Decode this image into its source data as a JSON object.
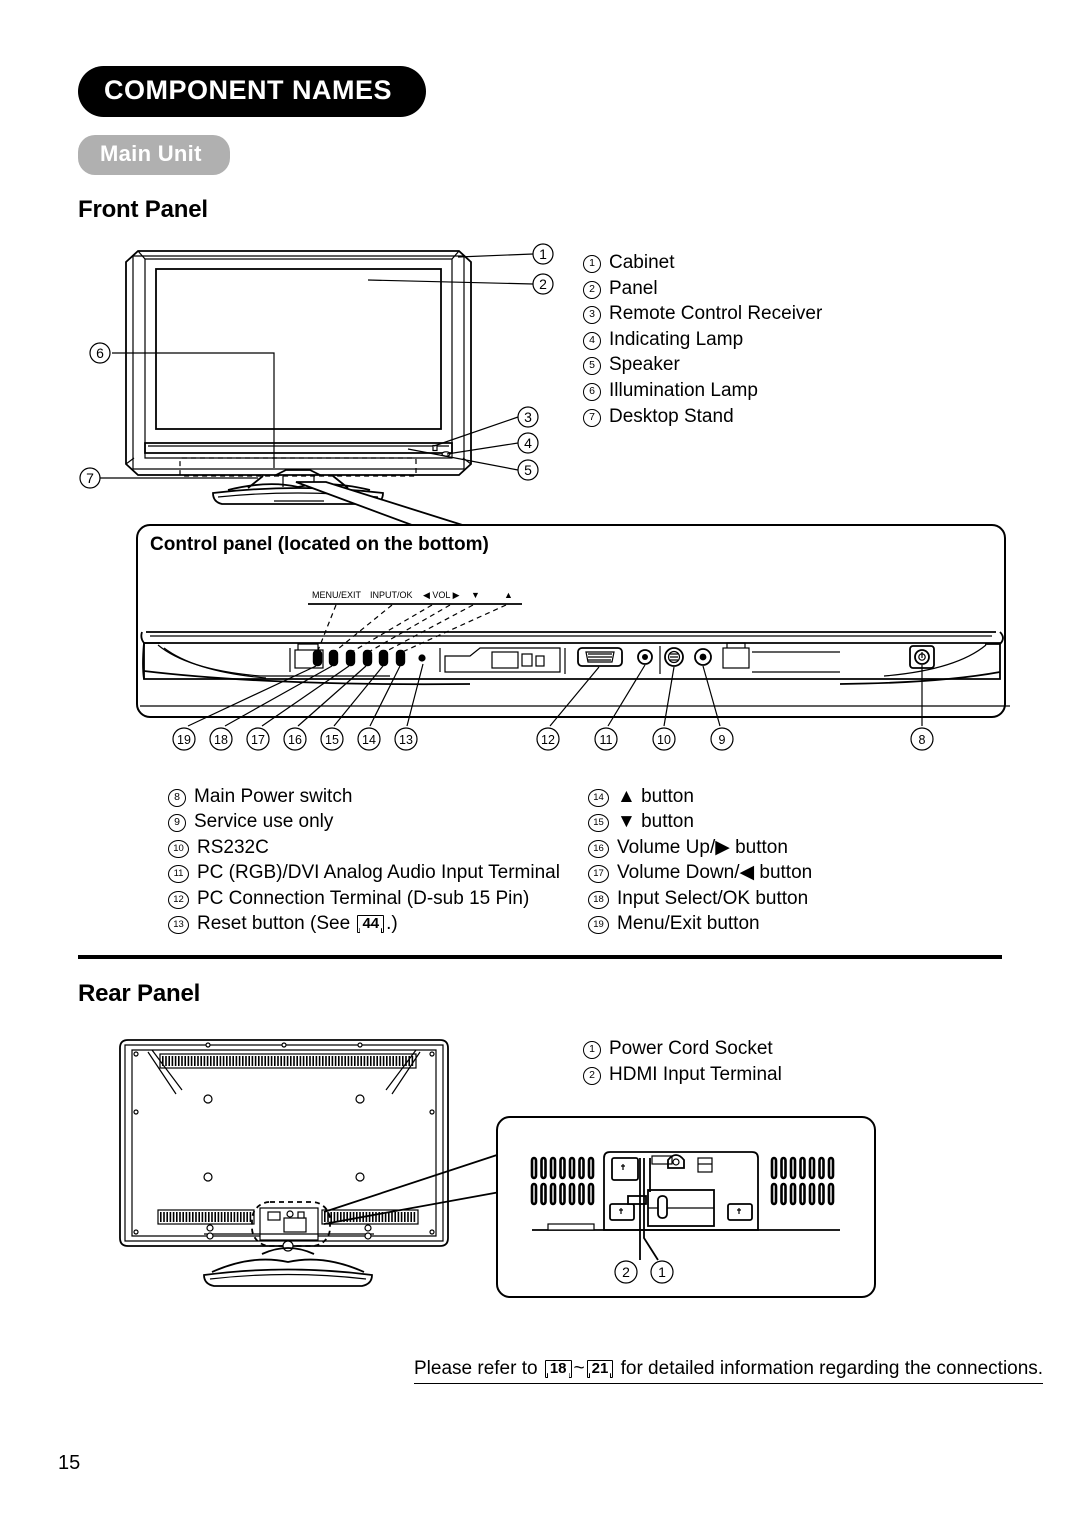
{
  "document": {
    "chapter_title": "COMPONENT NAMES",
    "subsection_title": "Main Unit",
    "page_number": "15"
  },
  "front_panel": {
    "heading": "Front Panel",
    "items": [
      {
        "num": "①",
        "n": "1",
        "label": "Cabinet"
      },
      {
        "num": "②",
        "n": "2",
        "label": "Panel"
      },
      {
        "num": "③",
        "n": "3",
        "label": "Remote Control Receiver"
      },
      {
        "num": "④",
        "n": "4",
        "label": "Indicating Lamp"
      },
      {
        "num": "⑤",
        "n": "5",
        "label": "Speaker"
      },
      {
        "num": "⑥",
        "n": "6",
        "label": "Illumination Lamp"
      },
      {
        "num": "⑦",
        "n": "7",
        "label": "Desktop Stand"
      }
    ],
    "diagram_callouts": [
      "1",
      "2",
      "3",
      "4",
      "5",
      "6",
      "7"
    ]
  },
  "control_panel": {
    "box_title": "Control panel (located on the bottom)",
    "button_labels": [
      "MENU/EXIT",
      "INPUT/OK",
      "◀ VOL ▶",
      "▼",
      "▲"
    ],
    "diagram_callouts_left": [
      "19",
      "18",
      "17",
      "16",
      "15",
      "14",
      "13"
    ],
    "diagram_callouts_right": [
      "12",
      "11",
      "10",
      "9"
    ],
    "diagram_callout_far": "8",
    "items_left": [
      {
        "n": "8",
        "label": "Main Power switch"
      },
      {
        "n": "9",
        "label": "Service use only"
      },
      {
        "n": "10",
        "label": "RS232C"
      },
      {
        "n": "11",
        "label": "PC (RGB)/DVI Analog Audio Input Terminal"
      },
      {
        "n": "12",
        "label": "PC Connection Terminal (D-sub 15 Pin)"
      },
      {
        "n": "13",
        "label_before": "Reset button (See ",
        "ref": "44",
        "label_after": ".)"
      }
    ],
    "items_right": [
      {
        "n": "14",
        "label": "▲ button"
      },
      {
        "n": "15",
        "label": "▼ button"
      },
      {
        "n": "16",
        "label": "Volume Up/▶ button"
      },
      {
        "n": "17",
        "label": "Volume Down/◀ button"
      },
      {
        "n": "18",
        "label": "Input Select/OK button"
      },
      {
        "n": "19",
        "label": "Menu/Exit button"
      }
    ]
  },
  "rear_panel": {
    "heading": "Rear Panel",
    "items": [
      {
        "num": "①",
        "n": "1",
        "label": "Power Cord Socket"
      },
      {
        "num": "②",
        "n": "2",
        "label": "HDMI Input Terminal"
      }
    ],
    "diagram_callouts": [
      "2",
      "1"
    ]
  },
  "footer": {
    "note_before": "Please refer to ",
    "ref_from": "18",
    "ref_sep": "~",
    "ref_to": "21",
    "note_after": " for detailed information regarding the connections."
  }
}
